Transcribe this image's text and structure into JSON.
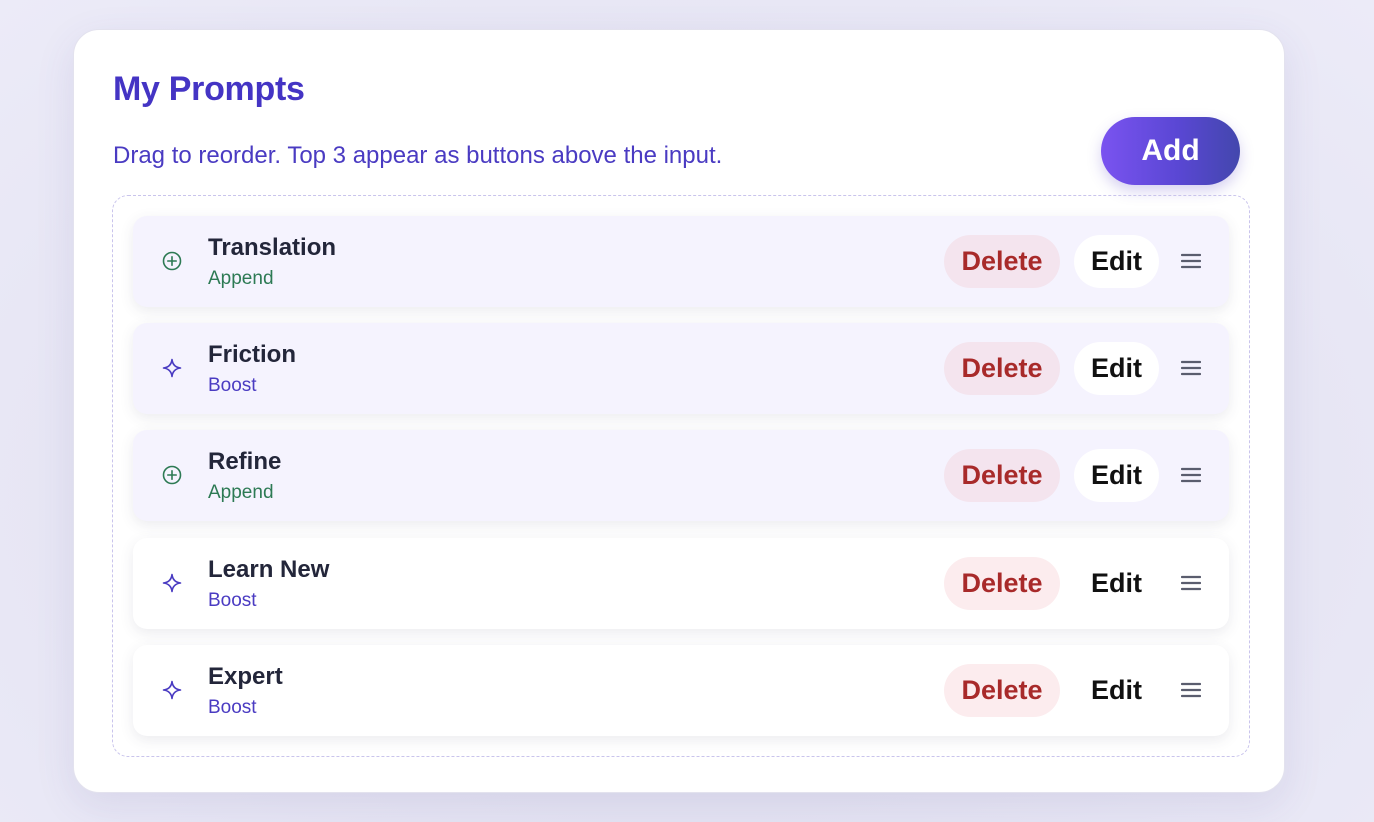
{
  "header": {
    "title": "My Prompts",
    "subtitle": "Drag to reorder. Top 3 appear as buttons above the input.",
    "add_label": "Add"
  },
  "colors": {
    "accent": "#4434c4",
    "append": "#2d7a54",
    "boost": "#4a3bc2",
    "delete": "#a82a2a"
  },
  "prompts": [
    {
      "name": "Translation",
      "type": "Append",
      "icon": "plus-circle-icon",
      "delete_label": "Delete",
      "edit_label": "Edit"
    },
    {
      "name": "Friction",
      "type": "Boost",
      "icon": "sparkle-icon",
      "delete_label": "Delete",
      "edit_label": "Edit"
    },
    {
      "name": "Refine",
      "type": "Append",
      "icon": "plus-circle-icon",
      "delete_label": "Delete",
      "edit_label": "Edit"
    },
    {
      "name": "Learn New",
      "type": "Boost",
      "icon": "sparkle-icon",
      "delete_label": "Delete",
      "edit_label": "Edit"
    },
    {
      "name": "Expert",
      "type": "Boost",
      "icon": "sparkle-icon",
      "delete_label": "Delete",
      "edit_label": "Edit"
    }
  ]
}
